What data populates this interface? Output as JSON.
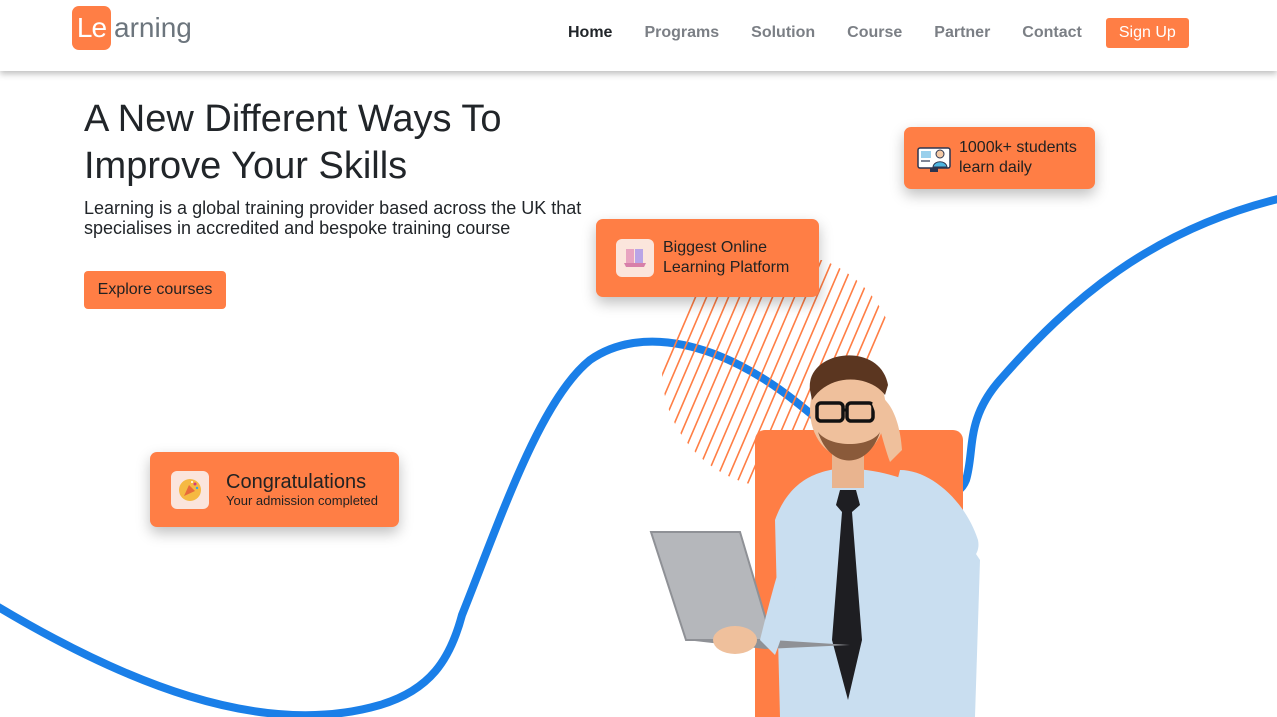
{
  "brand": {
    "logo_box": "Le",
    "logo_rest": "arning",
    "accent": "#ff7e45",
    "curve_color": "#1a7fe8"
  },
  "nav": {
    "items": [
      {
        "label": "Home",
        "active": true
      },
      {
        "label": "Programs"
      },
      {
        "label": "Solution"
      },
      {
        "label": "Course"
      },
      {
        "label": "Partner"
      },
      {
        "label": "Contact"
      }
    ],
    "signup": "Sign Up"
  },
  "hero": {
    "title_line1": "A New Different Ways To",
    "title_line2": "Improve Your Skills",
    "subtitle": "Learning is a global training provider based across the UK that specialises in accredited and bespoke training course",
    "cta": "Explore courses"
  },
  "cards": {
    "students": {
      "line1": "1000k+ students",
      "line2": "learn daily",
      "icon": "computer-teacher-icon"
    },
    "platform": {
      "line1": "Biggest Online",
      "line2": "Learning Platform",
      "icon": "books-icon"
    },
    "congrats": {
      "title": "Congratulations",
      "subtitle": "Your admission completed",
      "icon": "party-popper-icon"
    }
  }
}
